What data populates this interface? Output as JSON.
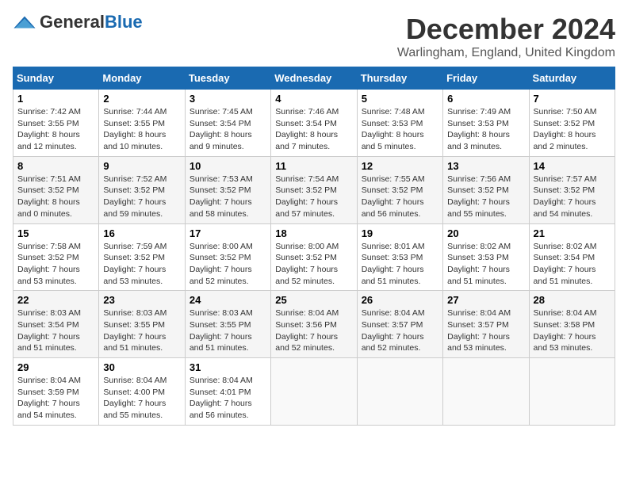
{
  "header": {
    "logo_general": "General",
    "logo_blue": "Blue",
    "month": "December 2024",
    "location": "Warlingham, England, United Kingdom"
  },
  "weekdays": [
    "Sunday",
    "Monday",
    "Tuesday",
    "Wednesday",
    "Thursday",
    "Friday",
    "Saturday"
  ],
  "weeks": [
    [
      {
        "day": "1",
        "sunrise": "Sunrise: 7:42 AM",
        "sunset": "Sunset: 3:55 PM",
        "daylight": "Daylight: 8 hours and 12 minutes."
      },
      {
        "day": "2",
        "sunrise": "Sunrise: 7:44 AM",
        "sunset": "Sunset: 3:55 PM",
        "daylight": "Daylight: 8 hours and 10 minutes."
      },
      {
        "day": "3",
        "sunrise": "Sunrise: 7:45 AM",
        "sunset": "Sunset: 3:54 PM",
        "daylight": "Daylight: 8 hours and 9 minutes."
      },
      {
        "day": "4",
        "sunrise": "Sunrise: 7:46 AM",
        "sunset": "Sunset: 3:54 PM",
        "daylight": "Daylight: 8 hours and 7 minutes."
      },
      {
        "day": "5",
        "sunrise": "Sunrise: 7:48 AM",
        "sunset": "Sunset: 3:53 PM",
        "daylight": "Daylight: 8 hours and 5 minutes."
      },
      {
        "day": "6",
        "sunrise": "Sunrise: 7:49 AM",
        "sunset": "Sunset: 3:53 PM",
        "daylight": "Daylight: 8 hours and 3 minutes."
      },
      {
        "day": "7",
        "sunrise": "Sunrise: 7:50 AM",
        "sunset": "Sunset: 3:52 PM",
        "daylight": "Daylight: 8 hours and 2 minutes."
      }
    ],
    [
      {
        "day": "8",
        "sunrise": "Sunrise: 7:51 AM",
        "sunset": "Sunset: 3:52 PM",
        "daylight": "Daylight: 8 hours and 0 minutes."
      },
      {
        "day": "9",
        "sunrise": "Sunrise: 7:52 AM",
        "sunset": "Sunset: 3:52 PM",
        "daylight": "Daylight: 7 hours and 59 minutes."
      },
      {
        "day": "10",
        "sunrise": "Sunrise: 7:53 AM",
        "sunset": "Sunset: 3:52 PM",
        "daylight": "Daylight: 7 hours and 58 minutes."
      },
      {
        "day": "11",
        "sunrise": "Sunrise: 7:54 AM",
        "sunset": "Sunset: 3:52 PM",
        "daylight": "Daylight: 7 hours and 57 minutes."
      },
      {
        "day": "12",
        "sunrise": "Sunrise: 7:55 AM",
        "sunset": "Sunset: 3:52 PM",
        "daylight": "Daylight: 7 hours and 56 minutes."
      },
      {
        "day": "13",
        "sunrise": "Sunrise: 7:56 AM",
        "sunset": "Sunset: 3:52 PM",
        "daylight": "Daylight: 7 hours and 55 minutes."
      },
      {
        "day": "14",
        "sunrise": "Sunrise: 7:57 AM",
        "sunset": "Sunset: 3:52 PM",
        "daylight": "Daylight: 7 hours and 54 minutes."
      }
    ],
    [
      {
        "day": "15",
        "sunrise": "Sunrise: 7:58 AM",
        "sunset": "Sunset: 3:52 PM",
        "daylight": "Daylight: 7 hours and 53 minutes."
      },
      {
        "day": "16",
        "sunrise": "Sunrise: 7:59 AM",
        "sunset": "Sunset: 3:52 PM",
        "daylight": "Daylight: 7 hours and 53 minutes."
      },
      {
        "day": "17",
        "sunrise": "Sunrise: 8:00 AM",
        "sunset": "Sunset: 3:52 PM",
        "daylight": "Daylight: 7 hours and 52 minutes."
      },
      {
        "day": "18",
        "sunrise": "Sunrise: 8:00 AM",
        "sunset": "Sunset: 3:52 PM",
        "daylight": "Daylight: 7 hours and 52 minutes."
      },
      {
        "day": "19",
        "sunrise": "Sunrise: 8:01 AM",
        "sunset": "Sunset: 3:53 PM",
        "daylight": "Daylight: 7 hours and 51 minutes."
      },
      {
        "day": "20",
        "sunrise": "Sunrise: 8:02 AM",
        "sunset": "Sunset: 3:53 PM",
        "daylight": "Daylight: 7 hours and 51 minutes."
      },
      {
        "day": "21",
        "sunrise": "Sunrise: 8:02 AM",
        "sunset": "Sunset: 3:54 PM",
        "daylight": "Daylight: 7 hours and 51 minutes."
      }
    ],
    [
      {
        "day": "22",
        "sunrise": "Sunrise: 8:03 AM",
        "sunset": "Sunset: 3:54 PM",
        "daylight": "Daylight: 7 hours and 51 minutes."
      },
      {
        "day": "23",
        "sunrise": "Sunrise: 8:03 AM",
        "sunset": "Sunset: 3:55 PM",
        "daylight": "Daylight: 7 hours and 51 minutes."
      },
      {
        "day": "24",
        "sunrise": "Sunrise: 8:03 AM",
        "sunset": "Sunset: 3:55 PM",
        "daylight": "Daylight: 7 hours and 51 minutes."
      },
      {
        "day": "25",
        "sunrise": "Sunrise: 8:04 AM",
        "sunset": "Sunset: 3:56 PM",
        "daylight": "Daylight: 7 hours and 52 minutes."
      },
      {
        "day": "26",
        "sunrise": "Sunrise: 8:04 AM",
        "sunset": "Sunset: 3:57 PM",
        "daylight": "Daylight: 7 hours and 52 minutes."
      },
      {
        "day": "27",
        "sunrise": "Sunrise: 8:04 AM",
        "sunset": "Sunset: 3:57 PM",
        "daylight": "Daylight: 7 hours and 53 minutes."
      },
      {
        "day": "28",
        "sunrise": "Sunrise: 8:04 AM",
        "sunset": "Sunset: 3:58 PM",
        "daylight": "Daylight: 7 hours and 53 minutes."
      }
    ],
    [
      {
        "day": "29",
        "sunrise": "Sunrise: 8:04 AM",
        "sunset": "Sunset: 3:59 PM",
        "daylight": "Daylight: 7 hours and 54 minutes."
      },
      {
        "day": "30",
        "sunrise": "Sunrise: 8:04 AM",
        "sunset": "Sunset: 4:00 PM",
        "daylight": "Daylight: 7 hours and 55 minutes."
      },
      {
        "day": "31",
        "sunrise": "Sunrise: 8:04 AM",
        "sunset": "Sunset: 4:01 PM",
        "daylight": "Daylight: 7 hours and 56 minutes."
      },
      null,
      null,
      null,
      null
    ]
  ]
}
